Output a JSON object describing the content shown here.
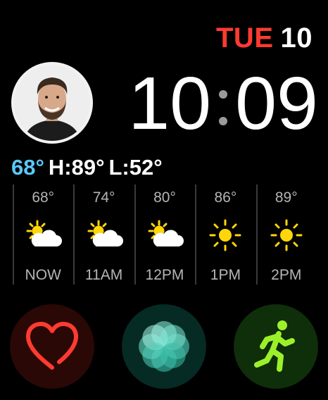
{
  "date": {
    "weekday": "TUE",
    "day": "10"
  },
  "time": {
    "hours": "10",
    "minutes": "09"
  },
  "current": {
    "temp": "68°",
    "hilo": "H:89°",
    "low": "L:52°"
  },
  "forecast": [
    {
      "temp": "68°",
      "label": "NOW",
      "icon": "partly-cloudy-icon"
    },
    {
      "temp": "74°",
      "label": "11AM",
      "icon": "partly-cloudy-icon"
    },
    {
      "temp": "80°",
      "label": "12PM",
      "icon": "partly-cloudy-icon"
    },
    {
      "temp": "86°",
      "label": "1PM",
      "icon": "sun-icon"
    },
    {
      "temp": "89°",
      "label": "2PM",
      "icon": "sun-icon"
    }
  ],
  "complications": [
    {
      "icon": "heart-icon"
    },
    {
      "icon": "breathe-icon"
    },
    {
      "icon": "workout-running-icon"
    }
  ],
  "colors": {
    "date_weekday": "#ff3b30",
    "current_temp": "#5ac8fa",
    "sun": "#ffd60a",
    "heart": "#ff3b30",
    "breathe": "#5cdbc6",
    "workout": "#9cf02a"
  }
}
